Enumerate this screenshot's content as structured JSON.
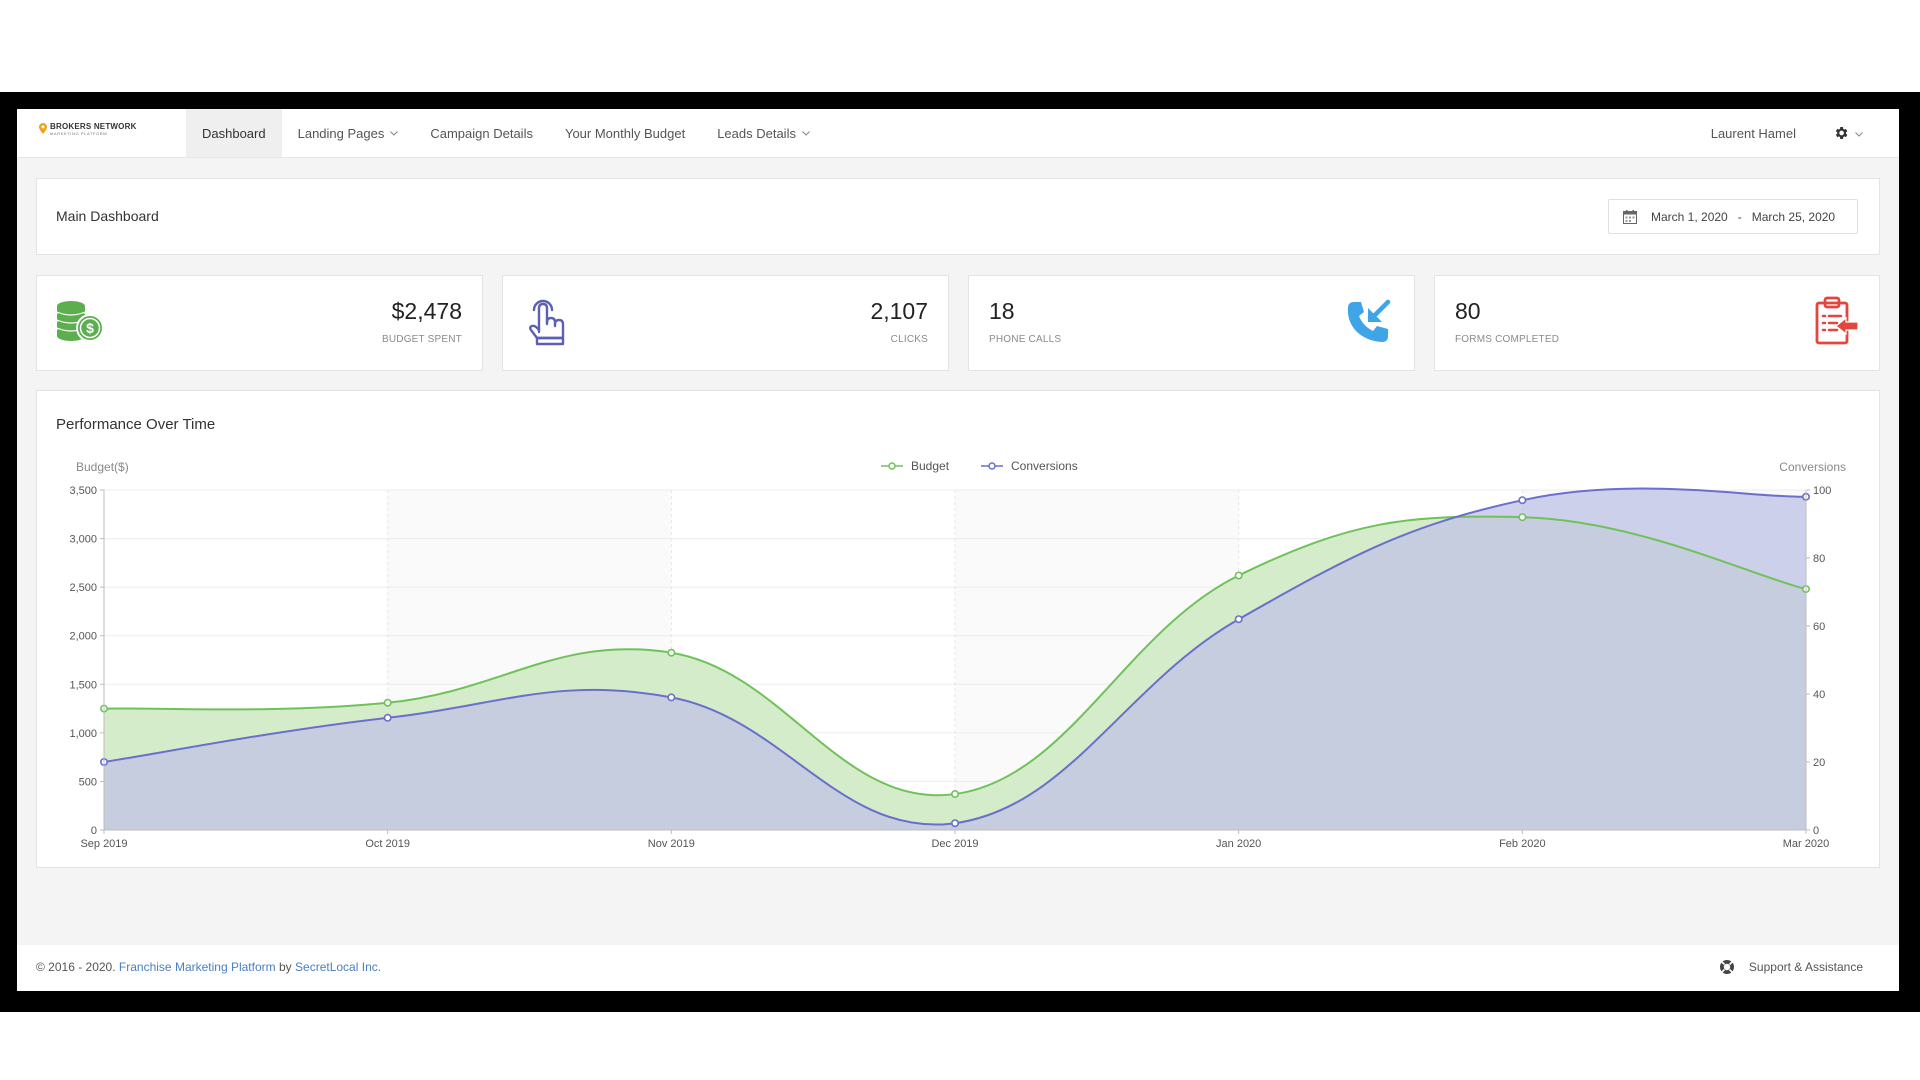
{
  "app": {
    "logo_title": "BROKERS NETWORK",
    "logo_subtitle": "MARKETING PLATFORM",
    "accent_color": "#4a7fc1"
  },
  "nav": {
    "items": [
      {
        "label": "Dashboard",
        "active": true,
        "has_dropdown": false
      },
      {
        "label": "Landing Pages",
        "active": false,
        "has_dropdown": true
      },
      {
        "label": "Campaign Details",
        "active": false,
        "has_dropdown": false
      },
      {
        "label": "Your Monthly Budget",
        "active": false,
        "has_dropdown": false
      },
      {
        "label": "Leads Details",
        "active": false,
        "has_dropdown": true
      }
    ],
    "user_name": "Laurent Hamel",
    "settings_icon": "gear-icon"
  },
  "header": {
    "title": "Main Dashboard",
    "date_start": "March 1, 2020",
    "date_sep": "-",
    "date_end": "March 25, 2020",
    "date_icon": "calendar-icon"
  },
  "stats": [
    {
      "value": "$2,478",
      "label": "BUDGET SPENT",
      "icon": "coins-dollar-icon",
      "color": "#5cae4e"
    },
    {
      "value": "2,107",
      "label": "CLICKS",
      "icon": "hand-pointer-icon",
      "color": "#5b5fb5"
    },
    {
      "value": "18",
      "label": "PHONE CALLS",
      "icon": "phone-incoming-icon",
      "color": "#3fa5e6"
    },
    {
      "value": "80",
      "label": "FORMS COMPLETED",
      "icon": "clipboard-arrow-icon",
      "color": "#e2463c"
    }
  ],
  "performance": {
    "title": "Performance Over Time"
  },
  "chart_data": {
    "type": "area",
    "categories": [
      "Sep 2019",
      "Oct 2019",
      "Nov 2019",
      "Dec 2019",
      "Jan 2020",
      "Feb 2020",
      "Mar 2020"
    ],
    "series": [
      {
        "name": "Budget",
        "axis": "left",
        "values": [
          1250,
          1310,
          1825,
          370,
          2620,
          3220,
          2480
        ],
        "color": "#6fc25a",
        "fill": "#d5ecca"
      },
      {
        "name": "Conversions",
        "axis": "right",
        "values": [
          20,
          33,
          39,
          2,
          62,
          97,
          98
        ],
        "color": "#6a6fcc",
        "fill": "#c0c4e6"
      }
    ],
    "ylabel_left": "Budget($)",
    "ylabel_right": "Conversions",
    "ylim_left": [
      0,
      3500
    ],
    "ylim_right": [
      0,
      100
    ],
    "yticks_left": [
      "0",
      "500",
      "1,000",
      "1,500",
      "2,000",
      "2,500",
      "3,000",
      "3,500"
    ],
    "yticks_right": [
      "0",
      "20",
      "40",
      "60",
      "80",
      "100"
    ],
    "legend": "top-center",
    "grid": true
  },
  "footer": {
    "copyright_prefix": "© 2016 - 2020.",
    "platform_link": "Franchise Marketing Platform",
    "by_text": "by",
    "company_link": "SecretLocal Inc.",
    "support_label": "Support & Assistance",
    "support_icon": "lifebuoy-icon"
  }
}
